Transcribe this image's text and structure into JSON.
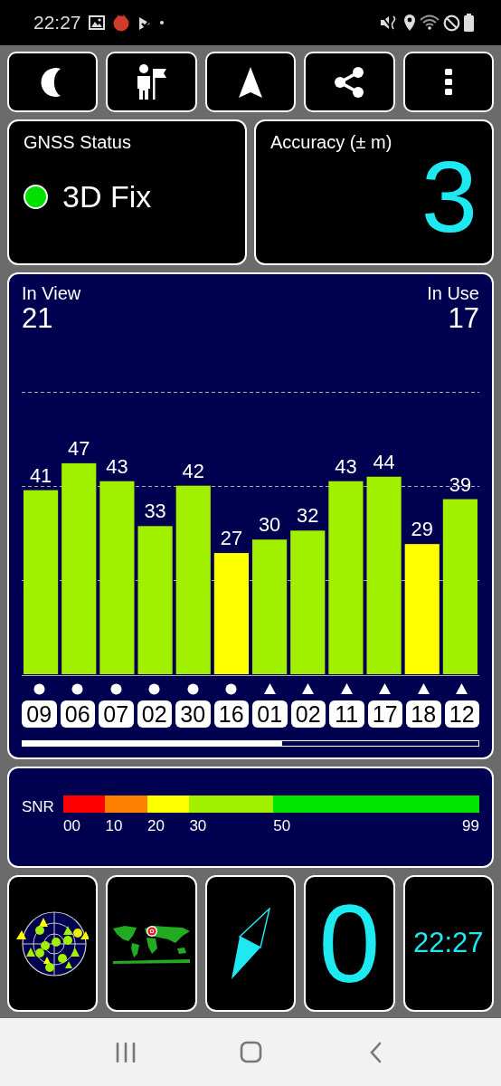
{
  "status_bar": {
    "time": "22:27"
  },
  "toolbar": [
    {
      "kind": "moon"
    },
    {
      "kind": "person_flag"
    },
    {
      "kind": "arrow"
    },
    {
      "kind": "share"
    },
    {
      "kind": "more"
    }
  ],
  "gnss_status": {
    "title": "GNSS Status",
    "fix": "3D Fix"
  },
  "accuracy": {
    "title": "Accuracy (± m)",
    "value": "3"
  },
  "satellites": {
    "in_view_label": "In View",
    "in_view": "21",
    "in_use_label": "In Use",
    "in_use": "17",
    "chart_data": {
      "type": "bar",
      "categories": [
        "09",
        "06",
        "07",
        "02",
        "30",
        "16",
        "01",
        "02",
        "11",
        "17",
        "18",
        "12"
      ],
      "data_labels": true,
      "values": [
        41,
        47,
        43,
        33,
        42,
        27,
        30,
        32,
        43,
        44,
        29,
        39
      ]
    },
    "markers": [
      {
        "kind": "circle"
      },
      {
        "kind": "circle"
      },
      {
        "kind": "circle"
      },
      {
        "kind": "circle"
      },
      {
        "kind": "circle"
      },
      {
        "kind": "circle"
      },
      {
        "kind": "triangle"
      },
      {
        "kind": "triangle"
      },
      {
        "kind": "triangle"
      },
      {
        "kind": "triangle"
      },
      {
        "kind": "triangle"
      },
      {
        "kind": "triangle"
      }
    ]
  },
  "snr_legend": {
    "label": "SNR",
    "end_label": "99",
    "segments": [
      {
        "label": "00",
        "color": "#ff0000"
      },
      {
        "label": "10",
        "color": "#ff8000"
      },
      {
        "label": "20",
        "color": "#ffff00"
      },
      {
        "label": "30",
        "color": "#a0f000"
      },
      {
        "label": "50",
        "color": "#00e600"
      }
    ]
  },
  "tiles": [
    {
      "kind": "sky_plot"
    },
    {
      "kind": "world_map"
    },
    {
      "kind": "compass"
    },
    {
      "kind": "number",
      "value": "0"
    },
    {
      "kind": "clock",
      "value": "22:27"
    }
  ],
  "nav_bar": [
    {
      "kind": "recents"
    },
    {
      "kind": "home"
    },
    {
      "kind": "back"
    }
  ]
}
